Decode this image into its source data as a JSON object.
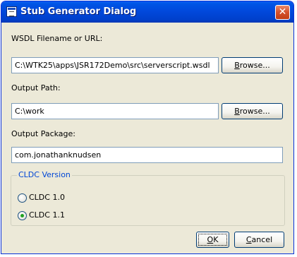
{
  "window": {
    "title": "Stub Generator Dialog",
    "close_glyph": "✕"
  },
  "wsdl": {
    "label": "WSDL Filename or URL:",
    "value": "C:\\WTK25\\apps\\JSR172Demo\\src\\serverscript.wsdl",
    "browse_prefix": "",
    "browse_mnemonic": "B",
    "browse_rest": "rowse..."
  },
  "output_path": {
    "label": "Output Path:",
    "value": "C:\\work",
    "browse_mnemonic": "B",
    "browse_rest": "rowse..."
  },
  "output_package": {
    "label": "Output Package:",
    "value": "com.jonathanknudsen"
  },
  "cldc": {
    "group_title": "CLDC Version",
    "options": [
      {
        "label": "CLDC 1.0",
        "checked": false
      },
      {
        "label": "CLDC 1.1",
        "checked": true
      }
    ]
  },
  "buttons": {
    "ok_mnemonic": "O",
    "ok_rest": "K",
    "cancel_mnemonic": "C",
    "cancel_rest": "ancel"
  },
  "colors": {
    "titlebar": "#0055e5",
    "dialog_bg": "#ece9d8",
    "group_title": "#0046d5",
    "radio_dot": "#21a121"
  },
  "icons": {
    "window": "app-window-icon",
    "close": "close-icon"
  }
}
